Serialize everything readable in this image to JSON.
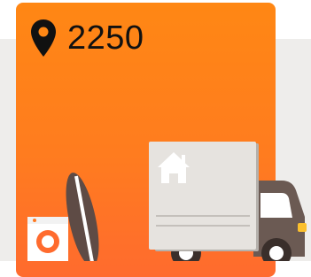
{
  "location": {
    "icon": "map-pin-icon",
    "postcode": "2250"
  },
  "illustration": {
    "items": [
      "washing-machine-icon",
      "surfboard-icon",
      "moving-box",
      "house-icon",
      "moving-truck"
    ]
  },
  "colors": {
    "card_top": "#ff8714",
    "card_bottom": "#ff6b2e",
    "backdrop": "#eeedeb",
    "truck_cab": "#6b5a53",
    "box": "#e6e3df"
  }
}
